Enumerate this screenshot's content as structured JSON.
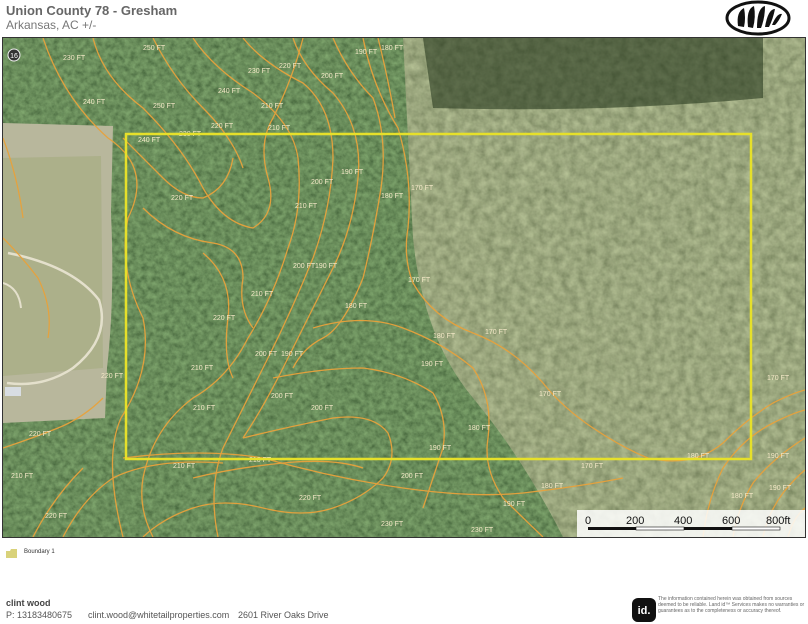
{
  "header": {
    "title": "Union County 78 - Gresham",
    "subtitle": "Arkansas,  AC +/-"
  },
  "map": {
    "road_marker": "16",
    "boundary_color": "#e6e02a",
    "contour_color": "#e8a23c",
    "contour_labels": [
      "250 FT",
      "230 FT",
      "240 FT",
      "250 FT",
      "240 FT",
      "230 FT",
      "220 FT",
      "210 FT",
      "200 FT",
      "190 FT",
      "180 FT",
      "240 FT",
      "230 FT",
      "220 FT",
      "210 FT",
      "200 FT",
      "190 FT",
      "180 FT",
      "170 FT",
      "220 FT",
      "210 FT",
      "200 FT",
      "190 FT",
      "180 FT",
      "170 FT",
      "210 FT",
      "200 FT",
      "190 FT",
      "180 FT",
      "170 FT",
      "170 FT",
      "170 FT",
      "180 FT",
      "190 FT",
      "200 FT",
      "210 FT",
      "220 FT",
      "210 FT",
      "200 FT",
      "190 FT",
      "180 FT",
      "170 FT",
      "220 FT",
      "220 FT",
      "210 FT",
      "210 FT",
      "220 FT",
      "230 FT",
      "230 FT",
      "220 FT",
      "210 FT",
      "200 FT",
      "190 FT",
      "180 FT",
      "190 FT",
      "180 FT",
      "190 FT"
    ],
    "scale_bar": {
      "labels": [
        "0",
        "200",
        "400",
        "600",
        "800ft"
      ]
    }
  },
  "legend": {
    "swatch_color": "#d9d27a",
    "label": "Boundary 1"
  },
  "footer": {
    "agent_name": "clint wood",
    "phone": "P: 13183480675",
    "email": "clint.wood@whitetailproperties.com",
    "address": "2601 River Oaks Drive",
    "badge_text": "id.",
    "disclaimer": "The information contained herein was obtained from sources deemed to be reliable. Land id™ Services makes no warranties or guarantees as to the completeness or accuracy thereof."
  }
}
